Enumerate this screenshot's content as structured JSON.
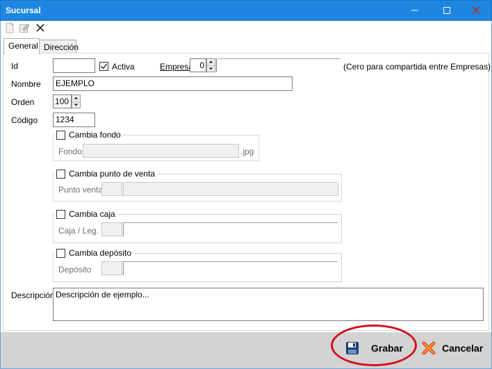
{
  "window": {
    "title": "Sucursal"
  },
  "toolbar": {
    "items": [
      {
        "icon": "new-document-icon"
      },
      {
        "icon": "edit-icon"
      },
      {
        "icon": "close-x-icon"
      }
    ]
  },
  "tabs": [
    {
      "label": "General"
    },
    {
      "label": "Dirección"
    }
  ],
  "form": {
    "id_label": "Id",
    "id_value": "",
    "activa_label": "Activa",
    "activa_checked": true,
    "empresa_label": "Empresa",
    "empresa_value": "0",
    "empresa_name": "",
    "empresa_hint": "(Cero para compartida entre Empresas)",
    "nombre_label": "Nombre",
    "nombre_value": "EJEMPLO",
    "orden_label": "Orden",
    "orden_value": "100",
    "codigo_label": "Código",
    "codigo_value": "1234",
    "fondo_group": {
      "checkbox_label": "Cambia fondo",
      "field_label": "Fondo",
      "value": "",
      "suffix": ".jpg"
    },
    "punto_group": {
      "checkbox_label": "Cambia punto de venta",
      "field_label": "Punto venta",
      "code": "",
      "name": ""
    },
    "caja_group": {
      "checkbox_label": "Cambia caja",
      "field_label": "Caja / Leg.",
      "code": "",
      "name": ""
    },
    "deposito_group": {
      "checkbox_label": "Cambia depósito",
      "field_label": "Depósito",
      "code": "",
      "name": ""
    },
    "descripcion_label": "Descripción",
    "descripcion_value": "Descripción de ejemplo..."
  },
  "actions": {
    "save_label": "Grabar",
    "cancel_label": "Cancelar"
  },
  "colors": {
    "title_bar": "#1e86e0",
    "bottom_bar": "#d3d3d3",
    "highlight": "#d3101a",
    "cancel_icon": "#e8471c"
  }
}
